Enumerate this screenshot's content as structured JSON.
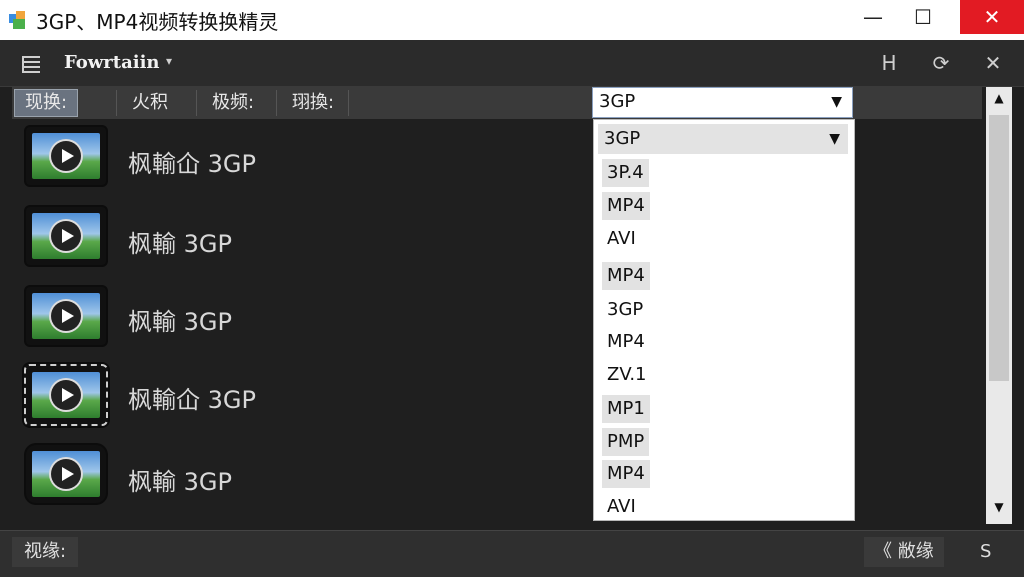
{
  "window": {
    "title": "3GP、MP4视频转换换精灵",
    "min_glyph": "—",
    "max_glyph": "☐",
    "close_glyph": "✕"
  },
  "toolbar": {
    "title": "Fowrtaiin",
    "caret": "▾",
    "icons": [
      "H",
      "⟳",
      "✕"
    ]
  },
  "filters": [
    {
      "label": "现换:",
      "active": true
    },
    {
      "label": "火积",
      "active": false
    },
    {
      "label": "极频:",
      "active": false
    },
    {
      "label": "珝換:",
      "active": false
    }
  ],
  "format_select": {
    "value": "3GP",
    "arrow": "▼"
  },
  "files": [
    {
      "label": "枫輸仚 3GP"
    },
    {
      "label": "枫輸 3GP"
    },
    {
      "label": "枫輸 3GP"
    },
    {
      "label": "枫輸仚 3GP"
    },
    {
      "label": "枫輸 3GP"
    }
  ],
  "dropdown": {
    "selected": "3GP",
    "arrow": "▼",
    "options": [
      {
        "label": "3P.4",
        "highlight": true
      },
      {
        "label": "MP4",
        "highlight": true
      },
      {
        "label": "AVI",
        "highlight": false
      },
      {
        "label": "MP4",
        "highlight": true
      },
      {
        "label": "3GP",
        "highlight": false
      },
      {
        "label": "MP4",
        "highlight": false
      },
      {
        "label": "ZV.1",
        "highlight": false
      },
      {
        "label": "MP1",
        "highlight": true
      },
      {
        "label": "PMP",
        "highlight": true
      },
      {
        "label": "MP4",
        "highlight": true
      },
      {
        "label": "AVI",
        "highlight": false
      }
    ]
  },
  "scrollbar": {
    "up": "▲",
    "down": "▼"
  },
  "status": {
    "left": "视缘:",
    "right": "《 敝缘",
    "end": "S"
  }
}
